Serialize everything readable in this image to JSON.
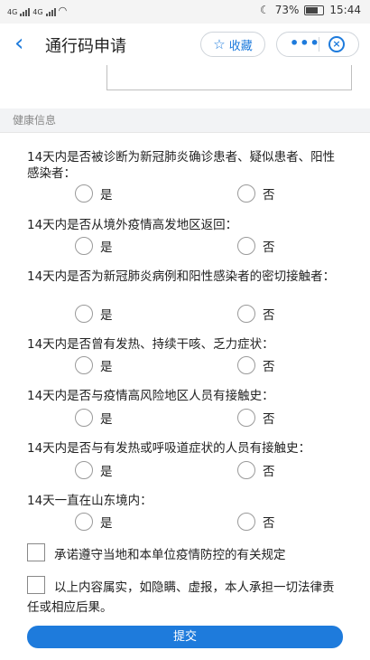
{
  "status_bar": {
    "battery": "73%",
    "time": "15:44",
    "net1": "4G",
    "net2": "4G"
  },
  "header": {
    "back_icon": "‹",
    "title": "通行码申请",
    "favorite_label": "收藏",
    "more_icon": "•••"
  },
  "section": {
    "title": "健康信息"
  },
  "questions": [
    {
      "text": "14天内是否被诊断为新冠肺炎确诊患者、疑似患者、阳性感染者：",
      "yes": "是",
      "no": "否"
    },
    {
      "text": "14天内是否从境外疫情高发地区返回：",
      "yes": "是",
      "no": "否"
    },
    {
      "text": "14天内是否为新冠肺炎病例和阳性感染者的密切接触者：",
      "yes": "是",
      "no": "否"
    },
    {
      "text": "14天内是否曾有发热、持续干咳、乏力症状：",
      "yes": "是",
      "no": "否"
    },
    {
      "text": "14天内是否与疫情高风险地区人员有接触史：",
      "yes": "是",
      "no": "否"
    },
    {
      "text": "14天内是否与有发热或呼吸道症状的人员有接触史：",
      "yes": "是",
      "no": "否"
    },
    {
      "text": "14天一直在山东境内：",
      "yes": "是",
      "no": "否"
    }
  ],
  "agreements": [
    {
      "text": "承诺遵守当地和本单位疫情防控的有关规定"
    },
    {
      "text": "以上内容属实，如隐瞒、虚报，本人承担一切法律责任或相应后果。"
    }
  ],
  "submit_label": "提交",
  "colors": {
    "accent": "#1e7bdc",
    "section_bg": "#f2f3f5"
  }
}
